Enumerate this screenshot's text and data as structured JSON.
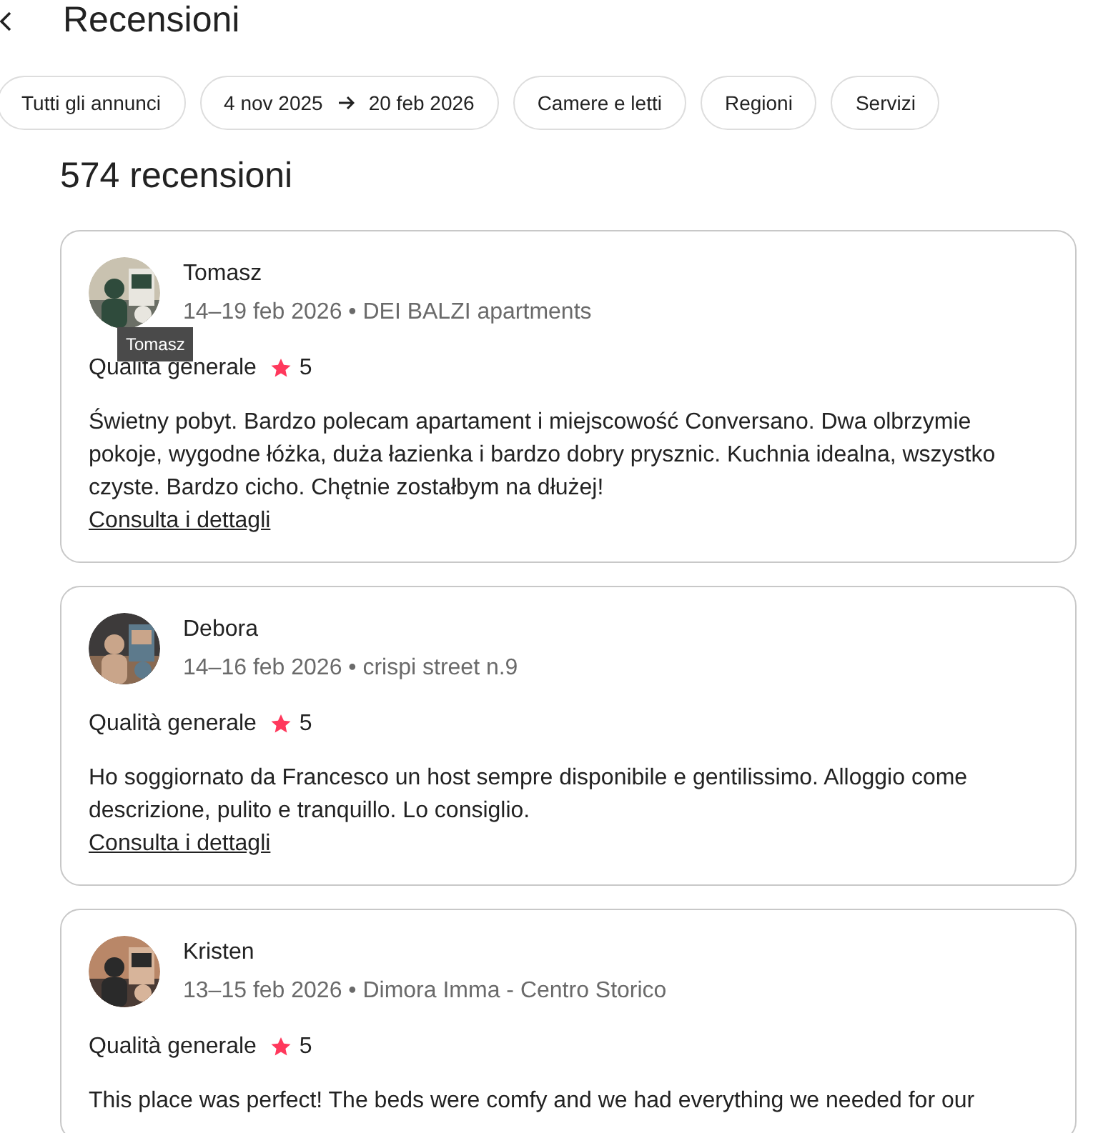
{
  "header": {
    "title": "Recensioni"
  },
  "filters": [
    {
      "label": "Tutti gli annunci"
    },
    {
      "label": "4 nov 2025",
      "label_end": "20 feb 2026",
      "kind": "range"
    },
    {
      "label": "Camere e letti"
    },
    {
      "label": "Regioni"
    },
    {
      "label": "Servizi"
    }
  ],
  "count": "574 recensioni",
  "reviews": [
    {
      "name": "Tomasz",
      "dates": "14–19 feb 2026",
      "separator": "•",
      "listing": "DEI BALZI apartments",
      "tooltip": "Tomasz",
      "rating_label": "Qualità generale",
      "rating": "5",
      "text": "Świetny pobyt. Bardzo polecam apartament i miejscowość Conversano. Dwa olbrzymie pokoje, wygodne łóżka, duża łazienka i bardzo dobry prysznic. Kuchnia idealna, wszystko czyste. Bardzo cicho. Chętnie zostałbym na dłużej!",
      "link": "Consulta i dettagli"
    },
    {
      "name": "Debora",
      "dates": "14–16 feb 2026",
      "separator": "•",
      "listing": "crispi street n.9",
      "rating_label": "Qualità generale",
      "rating": "5",
      "text": "Ho soggiornato da Francesco un host sempre disponibile e gentilissimo. Alloggio come descrizione, pulito e tranquillo. Lo consiglio.",
      "link": "Consulta i dettagli"
    },
    {
      "name": "Kristen",
      "dates": "13–15 feb 2026",
      "separator": "•",
      "listing": "Dimora Imma - Centro Storico",
      "rating_label": "Qualità generale",
      "rating": "5",
      "text": "This place was perfect! The beds were comfy and we had everything we needed for our"
    }
  ]
}
